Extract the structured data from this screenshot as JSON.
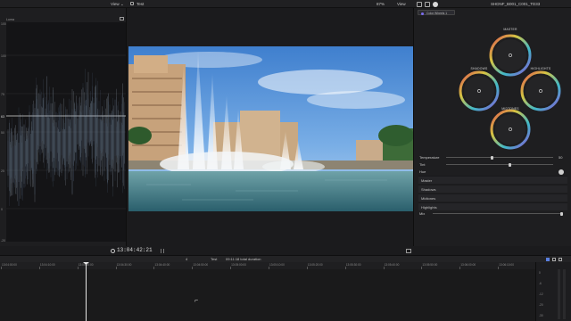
{
  "topbar": {
    "view_left": "View",
    "view_left_arrow": "⌄",
    "clip_name": "Test",
    "zoom": "87%",
    "view_right": "View",
    "clip_id": "SHDNF_B001_C001_TD33"
  },
  "scope": {
    "mode_label": "Luma",
    "scale": [
      "100",
      "75",
      "50",
      "25",
      "0",
      "-20"
    ]
  },
  "viewer": {
    "timecode": "13:04:42:21"
  },
  "inspector": {
    "color_effect": "Color Wheels 1",
    "wheels": {
      "master": "MASTER",
      "shadows": "SHADOWS",
      "highlights": "HIGHLIGHTS",
      "midtones": "MIDTONES"
    },
    "params": {
      "temperature_label": "Temperature",
      "temperature_value": "50",
      "tint_label": "Tint",
      "hue_label": "Hue"
    },
    "sections": [
      "Master",
      "Shadows",
      "Midtones",
      "Highlights"
    ],
    "mix_label": "Mix"
  },
  "timeline": {
    "project": "Test",
    "duration": "09:11:18 total duration",
    "index_num": "4",
    "ruler_ticks": [
      "13:04:00:00",
      "13:04:10:00",
      "13:04:20:00",
      "13:04:30:00",
      "13:04:40:00",
      "13:04:50:00",
      "13:05:00:00",
      "13:05:10:00",
      "13:05:20:00",
      "13:05:30:00",
      "13:05:40:00",
      "13:05:50:00",
      "13:06:00:00",
      "13:06:10:00"
    ]
  },
  "audio_meter": {
    "scale": [
      "0",
      "-6",
      "-12",
      "-20",
      "-30"
    ]
  },
  "colors": {
    "accent": "#7b6cf0",
    "playhead": "#e6e6e6",
    "panel": "#1e1e20"
  }
}
